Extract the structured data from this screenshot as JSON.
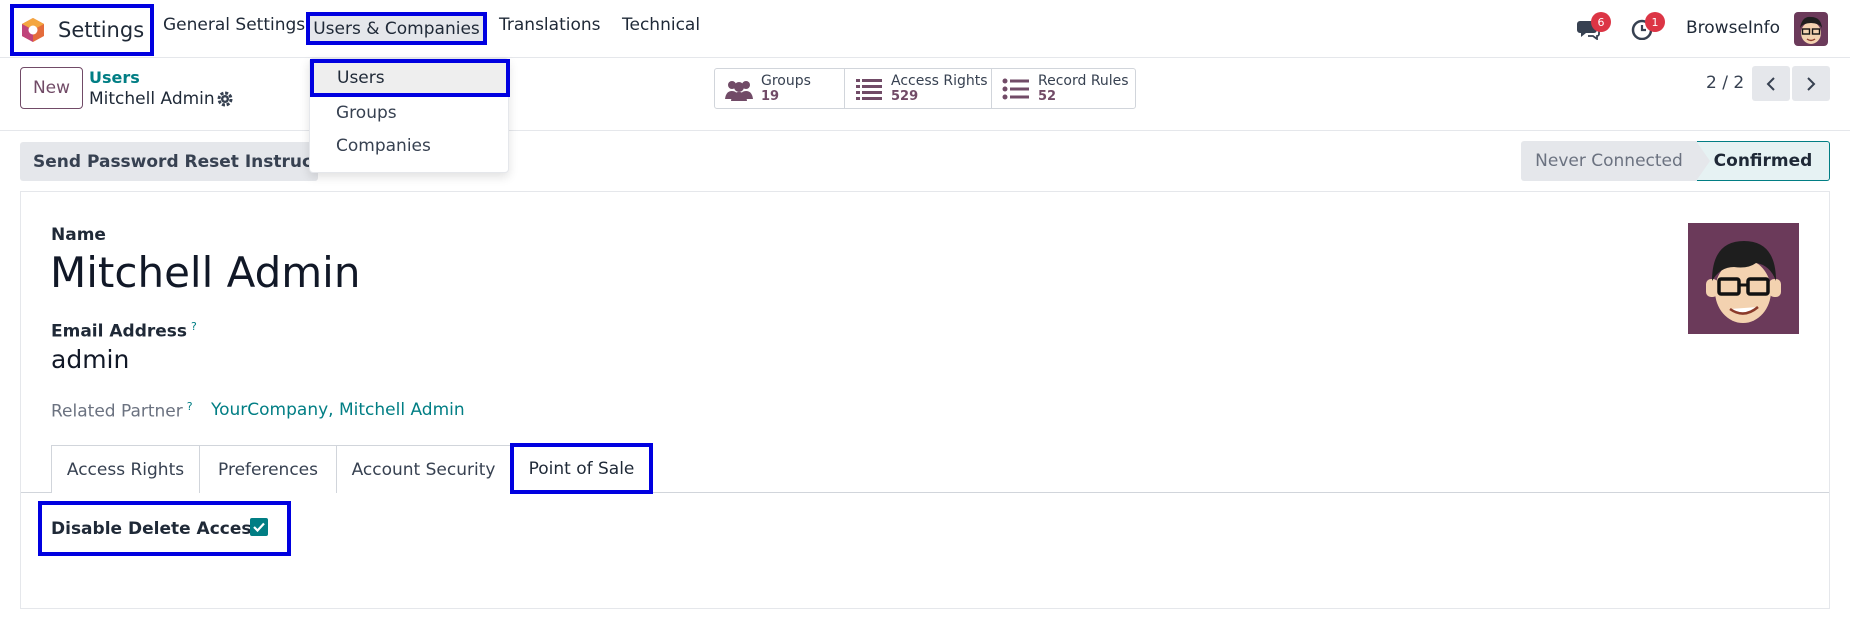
{
  "navbar": {
    "app_title": "Settings",
    "menus": [
      "General Settings",
      "Users & Companies",
      "Translations",
      "Technical"
    ],
    "messages_badge": "6",
    "activities_badge": "1",
    "company": "BrowseInfo"
  },
  "dropdown": {
    "items": [
      "Users",
      "Groups",
      "Companies"
    ]
  },
  "control_panel": {
    "new_label": "New",
    "breadcrumb_parent": "Users",
    "breadcrumb_current": "Mitchell Admin",
    "smart_buttons": [
      {
        "label": "Groups",
        "count": "19"
      },
      {
        "label": "Access Rights",
        "count": "529"
      },
      {
        "label": "Record Rules",
        "count": "52"
      }
    ],
    "pager": "2 / 2"
  },
  "statusbar": {
    "reset_label": "Send Password Reset Instructions",
    "states": [
      "Never Connected",
      "Confirmed"
    ]
  },
  "form": {
    "name_label": "Name",
    "name_value": "Mitchell Admin",
    "email_label": "Email Address",
    "email_help": "?",
    "email_value": "admin",
    "partner_label": "Related Partner",
    "partner_help": "?",
    "partner_value": "YourCompany, Mitchell Admin",
    "tabs": [
      "Access Rights",
      "Preferences",
      "Account Security",
      "Point of Sale"
    ],
    "delete_access_label": "Disable Delete Access",
    "delete_access_checked": true
  },
  "colors": {
    "primary": "#714b67",
    "teal": "#017e84",
    "highlight_border": "#0000e0",
    "badge": "#dc3545"
  },
  "icons": [
    "odoo-logo-icon",
    "chat-icon",
    "clock-icon",
    "gear-icon",
    "groups-icon",
    "list-icon",
    "chevron-left-icon",
    "chevron-right-icon",
    "checkmark-icon"
  ]
}
